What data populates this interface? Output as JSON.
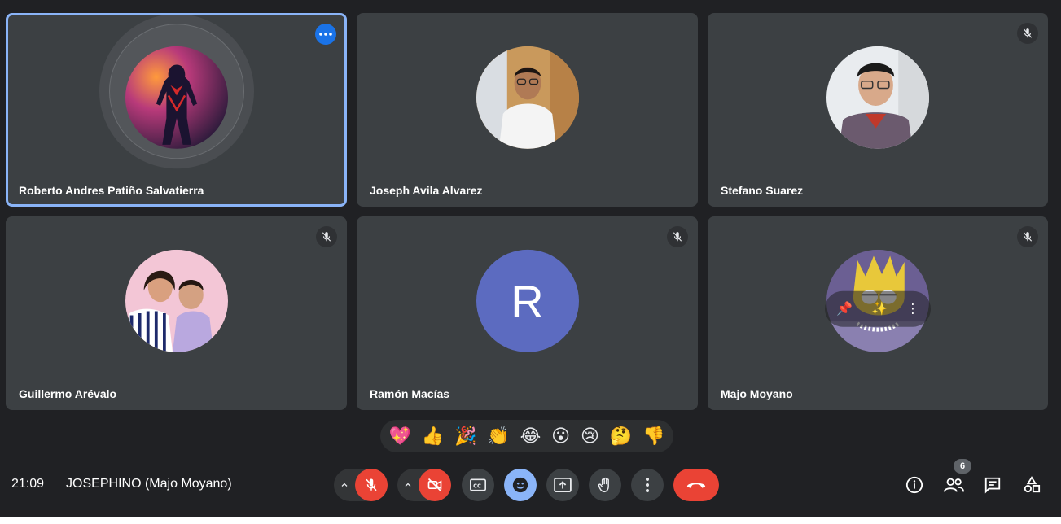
{
  "participants": [
    {
      "name": "Roberto Andres Patiño Salvatierra",
      "avatar": "spiderman-photo",
      "speaking": true
    },
    {
      "name": "Joseph Avila Alvarez",
      "avatar": "man-white-shirt-photo"
    },
    {
      "name": "Stefano Suarez",
      "avatar": "man-glasses-photo"
    },
    {
      "name": "Guillermo Arévalo",
      "avatar": "couple-photo"
    },
    {
      "name": "Ramón Macías",
      "avatar_letter": "R",
      "avatar_color": "#5c6bc0"
    },
    {
      "name": "Majo Moyano",
      "avatar": "lisa-simpson-image"
    }
  ],
  "reactions": [
    "💖",
    "👍",
    "🎉",
    "👏",
    "😂",
    "😮",
    "😢",
    "🤔",
    "👎"
  ],
  "meeting": {
    "time": "21:09",
    "title": "JOSEPHINO (Majo Moyano)"
  },
  "people_count": "6",
  "colors": {
    "background": "#202124",
    "tile": "#3c4043",
    "active_border": "#8ab4f8",
    "danger": "#ea4335",
    "accent_blue": "#1a73e8"
  }
}
